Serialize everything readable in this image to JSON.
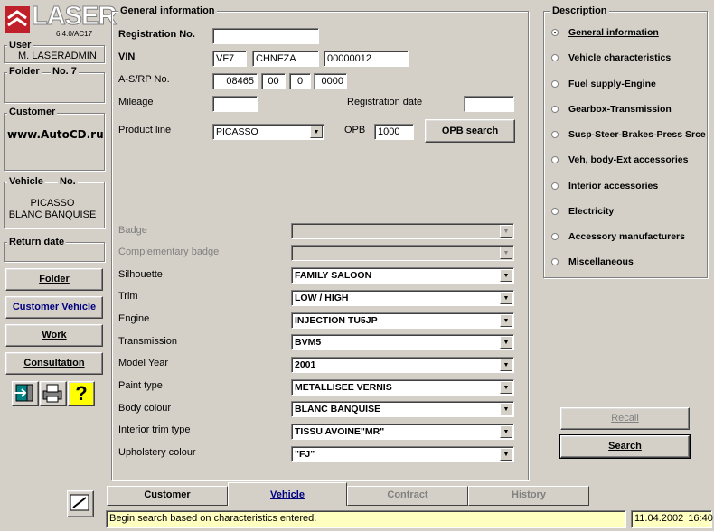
{
  "app": {
    "logo_text": "LASER",
    "version": "6.4.0/AC17"
  },
  "sidebar": {
    "user_label": "User",
    "user_value": "M. LASERADMIN",
    "folder_label": "Folder",
    "folder_no": "No. 7",
    "customer_label": "Customer",
    "customer_value": "www.AutoCD.ru",
    "vehicle_label": "Vehicle",
    "vehicle_no": "No.",
    "vehicle_line1": "PICASSO",
    "vehicle_line2": "BLANC BANQUISE",
    "return_date_label": "Return date",
    "buttons": [
      "Folder",
      "Customer Vehicle",
      "Work",
      "Consultation"
    ]
  },
  "general": {
    "title": "General information",
    "reg_label": "Registration No.",
    "reg_value": "",
    "vin_label": "VIN",
    "vin_1": "VF7",
    "vin_2": "CHNFZA",
    "vin_3": "00000012",
    "asrp_label": "A-S/RP No.",
    "asrp_1": "08465",
    "asrp_2": "00",
    "asrp_3": "0",
    "asrp_4": "0000",
    "mileage_label": "Mileage",
    "mileage_value": "",
    "regdate_label": "Registration date",
    "regdate_value": "",
    "product_line_label": "Product line",
    "product_line_value": "PICASSO",
    "opb_label": "OPB",
    "opb_value": "1000",
    "opb_search": "OPB search",
    "rows": [
      {
        "label": "Badge",
        "value": "",
        "disabled": true
      },
      {
        "label": "Complementary badge",
        "value": "",
        "disabled": true
      },
      {
        "label": "Silhouette",
        "value": "FAMILY SALOON"
      },
      {
        "label": "Trim",
        "value": "LOW / HIGH"
      },
      {
        "label": "Engine",
        "value": "INJECTION TU5JP"
      },
      {
        "label": "Transmission",
        "value": "BVM5"
      },
      {
        "label": "Model Year",
        "value": "2001"
      },
      {
        "label": "Paint type",
        "value": "METALLISEE VERNIS"
      },
      {
        "label": "Body colour",
        "value": "BLANC BANQUISE"
      },
      {
        "label": "Interior trim type",
        "value": "TISSU AVOINE\"MR\""
      },
      {
        "label": "Upholstery colour",
        "value": "\"FJ\""
      }
    ]
  },
  "description": {
    "title": "Description",
    "items": [
      "General information",
      "Vehicle characteristics",
      "Fuel supply-Engine",
      "Gearbox-Transmission",
      "Susp-Steer-Brakes-Press Srce",
      "Veh, body-Ext accessories",
      "Interior accessories",
      "Electricity",
      "Accessory manufacturers",
      "Miscellaneous"
    ],
    "selected": 0
  },
  "actions": {
    "recall": "Recall",
    "search": "Search"
  },
  "tabs": [
    "Customer",
    "Vehicle",
    "Contract",
    "History"
  ],
  "status": {
    "message": "Begin search based on characteristics entered.",
    "date": "11.04.2002",
    "time": "16:40"
  },
  "colors": {
    "face": "#d4d0c8",
    "status_bg": "#ffffc0",
    "active_tab": "#000080",
    "logo_red": "#c0202a"
  }
}
